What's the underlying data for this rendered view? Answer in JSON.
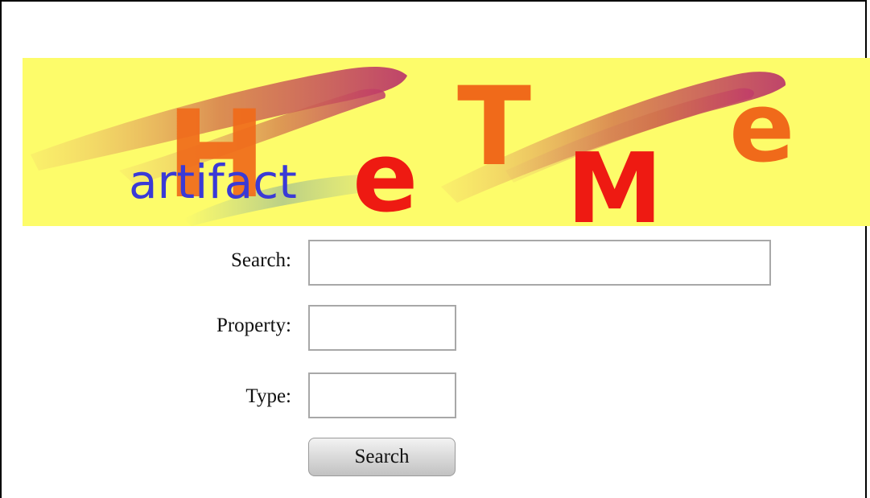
{
  "banner": {
    "letters": {
      "h": "H",
      "e1": "e",
      "t": "T",
      "m": "M",
      "e2": "e"
    },
    "tagline": "artifact",
    "colors": {
      "background": "#fdfc6a",
      "tagline": "#3a3ad6",
      "letters_orange": "#f06a1a",
      "letters_red": "#ee1a12",
      "brush": "#c84a3a"
    }
  },
  "form": {
    "search_label": "Search:",
    "search_value": "",
    "property_label": "Property:",
    "property_value": "",
    "type_label": "Type:",
    "type_value": "",
    "submit_label": "Search"
  }
}
